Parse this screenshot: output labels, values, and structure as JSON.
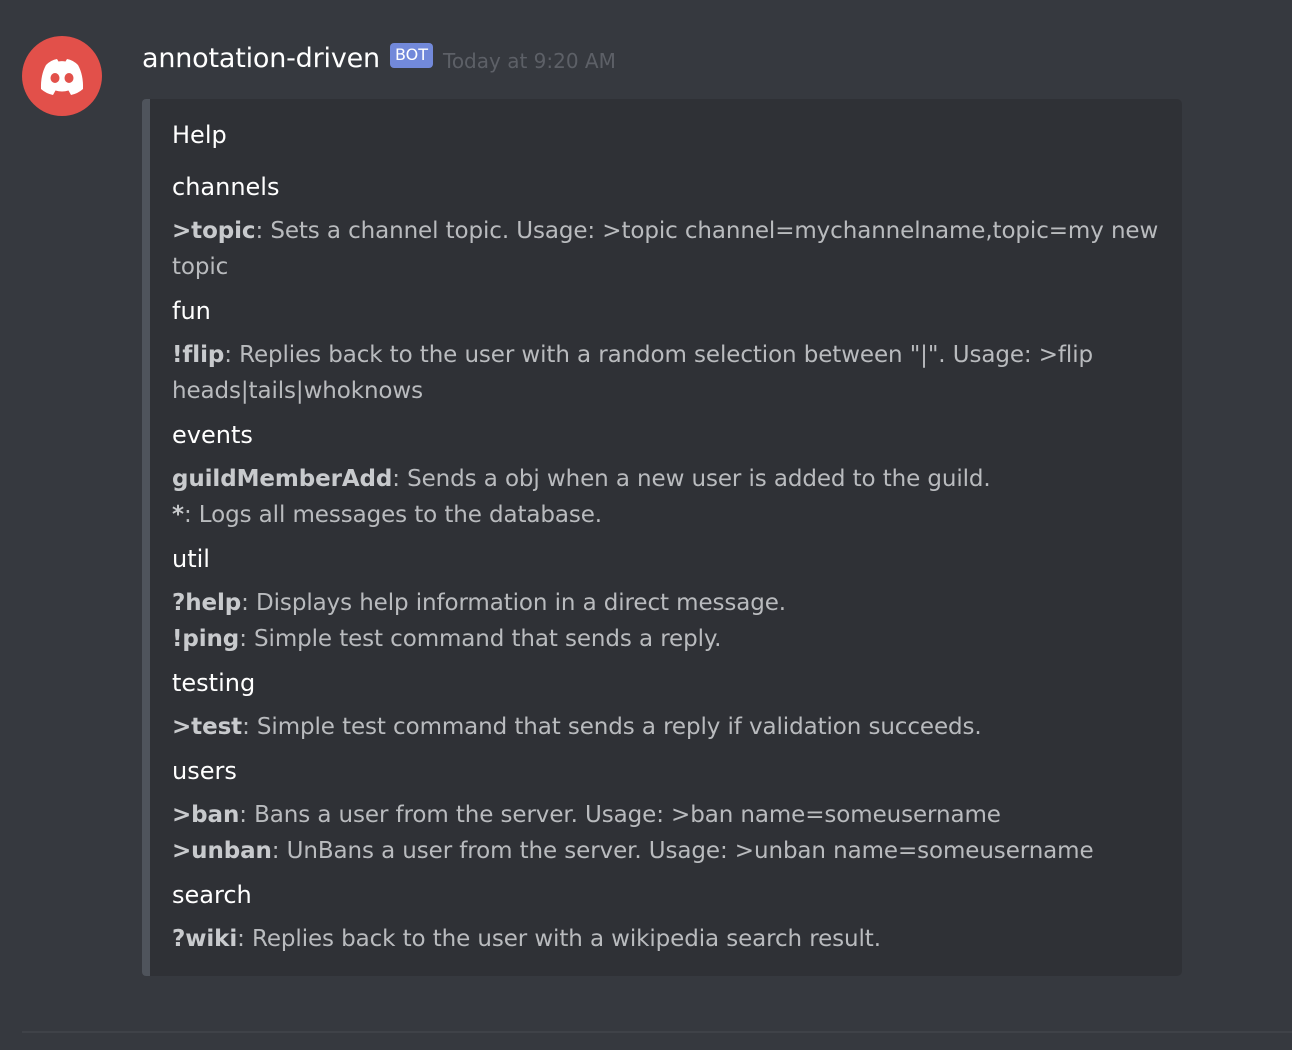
{
  "message": {
    "username": "annotation-driven",
    "bot_tag": "BOT",
    "timestamp": "Today at 9:20 AM",
    "avatar_icon": "discord-logo-icon",
    "avatar_color": "#e2504a"
  },
  "embed": {
    "title": "Help",
    "bar_color": "#4f545c",
    "fields": [
      {
        "name": "channels",
        "lines": [
          {
            "cmd": ">topic",
            "desc": ": Sets a channel topic. Usage: >topic channel=mychannelname,topic=my new topic"
          }
        ]
      },
      {
        "name": "fun",
        "lines": [
          {
            "cmd": "!flip",
            "desc": ": Replies back to the user with a random selection between \"|\". Usage: >flip heads|tails|whoknows"
          }
        ]
      },
      {
        "name": "events",
        "lines": [
          {
            "cmd": "guildMemberAdd",
            "desc": ": Sends a obj when a new user is added to the guild."
          },
          {
            "cmd": "*",
            "desc": ": Logs all messages to the database."
          }
        ]
      },
      {
        "name": "util",
        "lines": [
          {
            "cmd": "?help",
            "desc": ": Displays help information in a direct message."
          },
          {
            "cmd": "!ping",
            "desc": ": Simple test command that sends a reply."
          }
        ]
      },
      {
        "name": "testing",
        "lines": [
          {
            "cmd": ">test",
            "desc": ": Simple test command that sends a reply if validation succeeds."
          }
        ]
      },
      {
        "name": "users",
        "lines": [
          {
            "cmd": ">ban",
            "desc": ": Bans a user from the server. Usage: >ban name=someusername"
          },
          {
            "cmd": ">unban",
            "desc": ": UnBans a user from the server. Usage: >unban name=someusername"
          }
        ]
      },
      {
        "name": "search",
        "lines": [
          {
            "cmd": "?wiki",
            "desc": ": Replies back to the user with a wikipedia search result."
          }
        ]
      }
    ]
  }
}
